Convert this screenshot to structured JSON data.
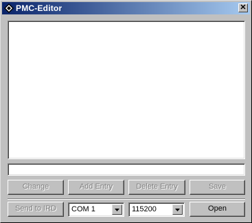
{
  "window": {
    "title": "PMC-Editor",
    "icon": "diamond-icon",
    "close_glyph": "✕"
  },
  "list": {
    "items": []
  },
  "entry_field": {
    "value": ""
  },
  "buttons": {
    "change": "Change",
    "add_entry": "Add Entry",
    "delete_entry": "Delete Entry",
    "save": "Save",
    "send_to_ird": "Send to IRD",
    "open": "Open"
  },
  "port_select": {
    "value": "COM 1"
  },
  "baud_select": {
    "value": "115200"
  }
}
